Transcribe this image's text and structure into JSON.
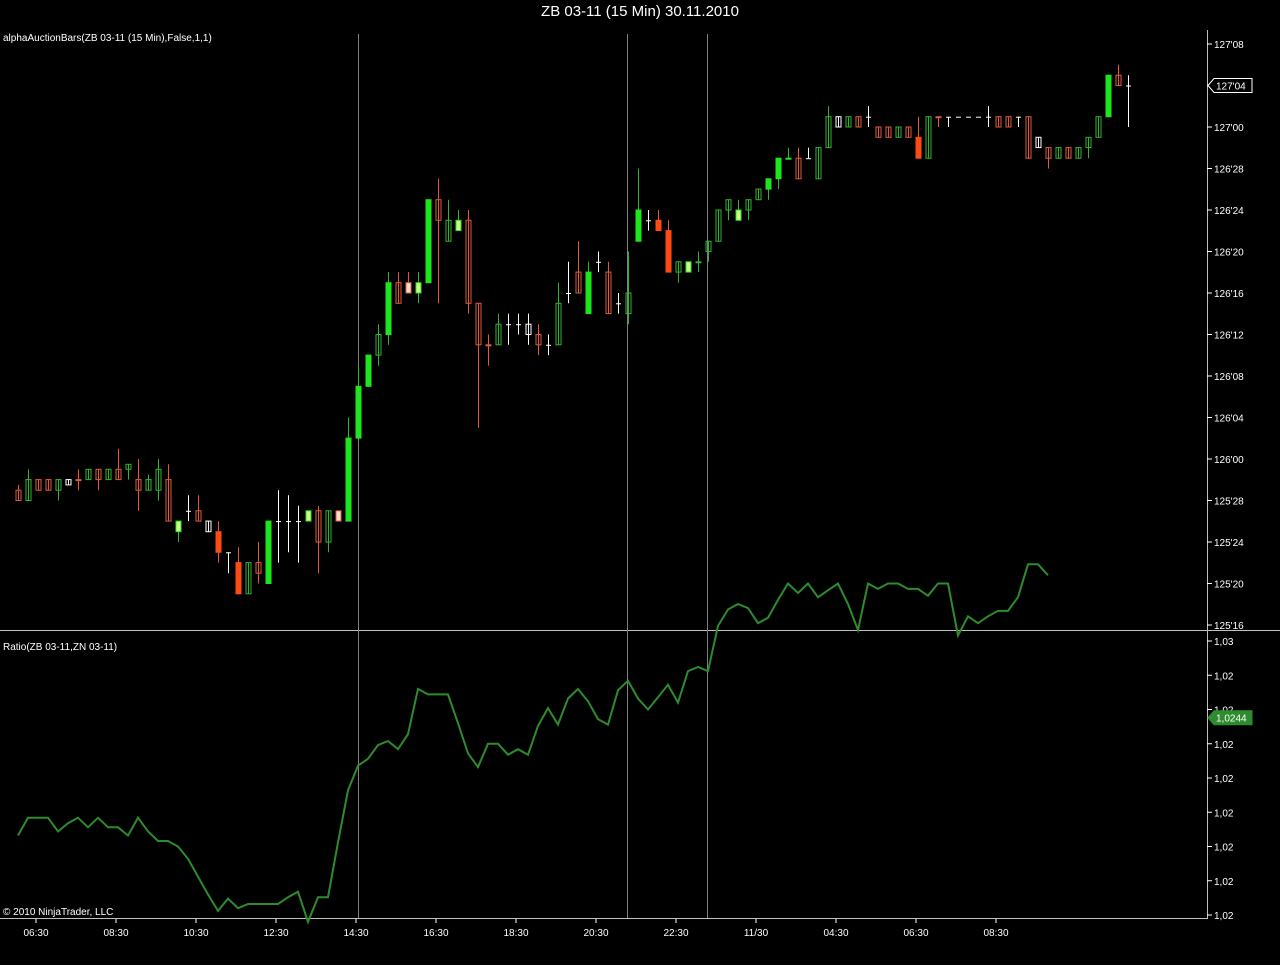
{
  "window": {
    "title": "ZB 03-11 (15 Min)  30.11.2010",
    "copyright": "© 2010 NinjaTrader, LLC"
  },
  "colors": {
    "background": "#000000",
    "up": "#1ee61e",
    "up_outline": "#32b432",
    "down": "#ff4a14",
    "down_outline": "#e05a3c",
    "neutral": "#ffffff",
    "ratio_line": "#2e8b2e",
    "axis": "#ffffff",
    "session_line": "#808080"
  },
  "chart_data": [
    {
      "type": "candlestick",
      "name": "alphaAuctionBars(ZB 03-11 (15 Min),False,1,1)",
      "y_axis": {
        "tick_labels": [
          "127'08",
          "127'04",
          "127'00",
          "126'28",
          "126'24",
          "126'20",
          "126'16",
          "126'12",
          "126'08",
          "126'04",
          "126'00",
          "125'28",
          "125'24",
          "125'20",
          "125'16"
        ],
        "tick_values": [
          127.25,
          127.125,
          127.0,
          126.875,
          126.75,
          126.625,
          126.5,
          126.375,
          126.25,
          126.125,
          126.0,
          125.875,
          125.75,
          125.625,
          125.5
        ],
        "range": [
          125.5,
          127.27
        ],
        "current_value_label": "127'04",
        "current_value": 127.125,
        "position": "right"
      },
      "x_axis": {
        "tick_labels": [
          "06:30",
          "08:30",
          "10:30",
          "12:30",
          "14:30",
          "16:30",
          "18:30",
          "20:30",
          "22:30",
          "11/30",
          "04:30",
          "06:30",
          "08:30"
        ]
      },
      "session_breaks": [
        "14:30",
        "21:15",
        "23:15"
      ],
      "bars": [
        {
          "o": 125.906,
          "h": 125.922,
          "l": 125.875,
          "c": 125.875,
          "k": "do"
        },
        {
          "o": 125.875,
          "h": 125.969,
          "l": 125.875,
          "c": 125.938,
          "k": "uo"
        },
        {
          "o": 125.906,
          "h": 125.938,
          "l": 125.906,
          "c": 125.938,
          "k": "do"
        },
        {
          "o": 125.906,
          "h": 125.938,
          "l": 125.906,
          "c": 125.938,
          "k": "do"
        },
        {
          "o": 125.938,
          "h": 125.938,
          "l": 125.875,
          "c": 125.906,
          "k": "uo"
        },
        {
          "o": 125.938,
          "h": 125.938,
          "l": 125.922,
          "c": 125.922,
          "k": "w"
        },
        {
          "o": 125.938,
          "h": 125.969,
          "l": 125.906,
          "c": 125.938,
          "k": "do"
        },
        {
          "o": 125.938,
          "h": 125.969,
          "l": 125.938,
          "c": 125.969,
          "k": "uo"
        },
        {
          "o": 125.969,
          "h": 125.969,
          "l": 125.906,
          "c": 125.938,
          "k": "do"
        },
        {
          "o": 125.938,
          "h": 125.969,
          "l": 125.938,
          "c": 125.969,
          "k": "uo"
        },
        {
          "o": 125.969,
          "h": 126.031,
          "l": 125.938,
          "c": 125.938,
          "k": "do"
        },
        {
          "o": 125.969,
          "h": 125.984,
          "l": 125.938,
          "c": 125.984,
          "k": "uo"
        },
        {
          "o": 125.938,
          "h": 126.0,
          "l": 125.844,
          "c": 125.906,
          "k": "do"
        },
        {
          "o": 125.906,
          "h": 125.953,
          "l": 125.906,
          "c": 125.938,
          "k": "uo"
        },
        {
          "o": 125.906,
          "h": 126.0,
          "l": 125.875,
          "c": 125.969,
          "k": "uo"
        },
        {
          "o": 125.938,
          "h": 125.984,
          "l": 125.813,
          "c": 125.813,
          "k": "do"
        },
        {
          "o": 125.813,
          "h": 125.813,
          "l": 125.75,
          "c": 125.781,
          "k": "ys"
        },
        {
          "o": 125.844,
          "h": 125.891,
          "l": 125.813,
          "c": 125.844,
          "k": "w"
        },
        {
          "o": 125.844,
          "h": 125.891,
          "l": 125.813,
          "c": 125.813,
          "k": "do"
        },
        {
          "o": 125.813,
          "h": 125.813,
          "l": 125.781,
          "c": 125.781,
          "k": "w"
        },
        {
          "o": 125.781,
          "h": 125.813,
          "l": 125.688,
          "c": 125.719,
          "k": "ds"
        },
        {
          "o": 125.719,
          "h": 125.719,
          "l": 125.656,
          "c": 125.719,
          "k": "w"
        },
        {
          "o": 125.688,
          "h": 125.734,
          "l": 125.594,
          "c": 125.594,
          "k": "ds"
        },
        {
          "o": 125.594,
          "h": 125.688,
          "l": 125.594,
          "c": 125.688,
          "k": "uo"
        },
        {
          "o": 125.688,
          "h": 125.75,
          "l": 125.625,
          "c": 125.656,
          "k": "do"
        },
        {
          "o": 125.625,
          "h": 125.813,
          "l": 125.625,
          "c": 125.813,
          "k": "us"
        },
        {
          "o": 125.813,
          "h": 125.906,
          "l": 125.688,
          "c": 125.813,
          "k": "w"
        },
        {
          "o": 125.813,
          "h": 125.891,
          "l": 125.719,
          "c": 125.813,
          "k": "w"
        },
        {
          "o": 125.813,
          "h": 125.859,
          "l": 125.688,
          "c": 125.813,
          "k": "w"
        },
        {
          "o": 125.844,
          "h": 125.844,
          "l": 125.813,
          "c": 125.813,
          "k": "ys"
        },
        {
          "o": 125.844,
          "h": 125.859,
          "l": 125.656,
          "c": 125.75,
          "k": "do"
        },
        {
          "o": 125.75,
          "h": 125.844,
          "l": 125.719,
          "c": 125.844,
          "k": "uo"
        },
        {
          "o": 125.844,
          "h": 125.844,
          "l": 125.813,
          "c": 125.813,
          "k": "pw"
        },
        {
          "o": 125.813,
          "h": 126.125,
          "l": 125.813,
          "c": 126.063,
          "k": "us"
        },
        {
          "o": 126.063,
          "h": 126.281,
          "l": 126.063,
          "c": 126.219,
          "k": "us"
        },
        {
          "o": 126.219,
          "h": 126.313,
          "l": 126.219,
          "c": 126.313,
          "k": "us"
        },
        {
          "o": 126.313,
          "h": 126.406,
          "l": 126.281,
          "c": 126.375,
          "k": "uo"
        },
        {
          "o": 126.375,
          "h": 126.563,
          "l": 126.344,
          "c": 126.531,
          "k": "us"
        },
        {
          "o": 126.531,
          "h": 126.563,
          "l": 126.469,
          "c": 126.469,
          "k": "do"
        },
        {
          "o": 126.531,
          "h": 126.563,
          "l": 126.5,
          "c": 126.5,
          "k": "pw"
        },
        {
          "o": 126.5,
          "h": 126.563,
          "l": 126.469,
          "c": 126.531,
          "k": "ys"
        },
        {
          "o": 126.531,
          "h": 126.781,
          "l": 126.531,
          "c": 126.781,
          "k": "us"
        },
        {
          "o": 126.781,
          "h": 126.844,
          "l": 126.469,
          "c": 126.719,
          "k": "do"
        },
        {
          "o": 126.656,
          "h": 126.781,
          "l": 126.656,
          "c": 126.719,
          "k": "uo"
        },
        {
          "o": 126.719,
          "h": 126.75,
          "l": 126.688,
          "c": 126.688,
          "k": "ys"
        },
        {
          "o": 126.719,
          "h": 126.75,
          "l": 126.438,
          "c": 126.469,
          "k": "do"
        },
        {
          "o": 126.469,
          "h": 126.469,
          "l": 126.094,
          "c": 126.344,
          "k": "do"
        },
        {
          "o": 126.344,
          "h": 126.375,
          "l": 126.281,
          "c": 126.344,
          "k": "pw"
        },
        {
          "o": 126.344,
          "h": 126.438,
          "l": 126.344,
          "c": 126.406,
          "k": "uo"
        },
        {
          "o": 126.406,
          "h": 126.438,
          "l": 126.344,
          "c": 126.406,
          "k": "w"
        },
        {
          "o": 126.406,
          "h": 126.438,
          "l": 126.375,
          "c": 126.406,
          "k": "w"
        },
        {
          "o": 126.406,
          "h": 126.438,
          "l": 126.344,
          "c": 126.375,
          "k": "w"
        },
        {
          "o": 126.375,
          "h": 126.406,
          "l": 126.313,
          "c": 126.344,
          "k": "do"
        },
        {
          "o": 126.344,
          "h": 126.375,
          "l": 126.313,
          "c": 126.344,
          "k": "w"
        },
        {
          "o": 126.344,
          "h": 126.531,
          "l": 126.344,
          "c": 126.469,
          "k": "uo"
        },
        {
          "o": 126.5,
          "h": 126.594,
          "l": 126.469,
          "c": 126.5,
          "k": "w"
        },
        {
          "o": 126.5,
          "h": 126.656,
          "l": 126.5,
          "c": 126.563,
          "k": "do"
        },
        {
          "o": 126.563,
          "h": 126.594,
          "l": 126.438,
          "c": 126.438,
          "k": "us"
        },
        {
          "o": 126.594,
          "h": 126.625,
          "l": 126.563,
          "c": 126.594,
          "k": "w"
        },
        {
          "o": 126.563,
          "h": 126.594,
          "l": 126.438,
          "c": 126.438,
          "k": "do"
        },
        {
          "o": 126.469,
          "h": 126.5,
          "l": 126.438,
          "c": 126.469,
          "k": "w"
        },
        {
          "o": 126.438,
          "h": 126.625,
          "l": 126.406,
          "c": 126.5,
          "k": "uo"
        },
        {
          "o": 126.656,
          "h": 126.875,
          "l": 126.656,
          "c": 126.75,
          "k": "us"
        },
        {
          "o": 126.719,
          "h": 126.75,
          "l": 126.688,
          "c": 126.719,
          "k": "w"
        },
        {
          "o": 126.719,
          "h": 126.75,
          "l": 126.688,
          "c": 126.688,
          "k": "ds"
        },
        {
          "o": 126.688,
          "h": 126.719,
          "l": 126.563,
          "c": 126.563,
          "k": "ds"
        },
        {
          "o": 126.594,
          "h": 126.594,
          "l": 126.531,
          "c": 126.563,
          "k": "uo"
        },
        {
          "o": 126.563,
          "h": 126.594,
          "l": 126.563,
          "c": 126.594,
          "k": "ys"
        },
        {
          "o": 126.594,
          "h": 126.625,
          "l": 126.563,
          "c": 126.594,
          "k": "uo"
        },
        {
          "o": 126.625,
          "h": 126.656,
          "l": 126.594,
          "c": 126.656,
          "k": "uo"
        },
        {
          "o": 126.656,
          "h": 126.75,
          "l": 126.656,
          "c": 126.75,
          "k": "uo"
        },
        {
          "o": 126.75,
          "h": 126.781,
          "l": 126.719,
          "c": 126.781,
          "k": "uo"
        },
        {
          "o": 126.75,
          "h": 126.781,
          "l": 126.719,
          "c": 126.719,
          "k": "ys"
        },
        {
          "o": 126.75,
          "h": 126.781,
          "l": 126.719,
          "c": 126.781,
          "k": "uo"
        },
        {
          "o": 126.781,
          "h": 126.813,
          "l": 126.781,
          "c": 126.813,
          "k": "uo"
        },
        {
          "o": 126.813,
          "h": 126.844,
          "l": 126.781,
          "c": 126.844,
          "k": "us"
        },
        {
          "o": 126.844,
          "h": 126.906,
          "l": 126.813,
          "c": 126.906,
          "k": "us"
        },
        {
          "o": 126.906,
          "h": 126.938,
          "l": 126.906,
          "c": 126.906,
          "k": "ys"
        },
        {
          "o": 126.906,
          "h": 126.938,
          "l": 126.844,
          "c": 126.844,
          "k": "do"
        },
        {
          "o": 126.906,
          "h": 126.938,
          "l": 126.906,
          "c": 126.906,
          "k": "w"
        },
        {
          "o": 126.844,
          "h": 126.938,
          "l": 126.844,
          "c": 126.938,
          "k": "uo"
        },
        {
          "o": 126.938,
          "h": 127.063,
          "l": 126.938,
          "c": 127.031,
          "k": "uo"
        },
        {
          "o": 127.031,
          "h": 127.031,
          "l": 127.0,
          "c": 127.0,
          "k": "w"
        },
        {
          "o": 127.0,
          "h": 127.031,
          "l": 127.0,
          "c": 127.031,
          "k": "uo"
        },
        {
          "o": 127.031,
          "h": 127.031,
          "l": 127.0,
          "c": 127.0,
          "k": "do"
        },
        {
          "o": 127.031,
          "h": 127.063,
          "l": 127.0,
          "c": 127.031,
          "k": "w"
        },
        {
          "o": 127.0,
          "h": 127.0,
          "l": 126.969,
          "c": 126.969,
          "k": "do"
        },
        {
          "o": 126.969,
          "h": 127.0,
          "l": 126.969,
          "c": 127.0,
          "k": "do"
        },
        {
          "o": 126.969,
          "h": 127.0,
          "l": 126.969,
          "c": 127.0,
          "k": "uo"
        },
        {
          "o": 127.0,
          "h": 127.0,
          "l": 126.969,
          "c": 126.969,
          "k": "do"
        },
        {
          "o": 126.969,
          "h": 127.031,
          "l": 126.906,
          "c": 126.906,
          "k": "ds"
        },
        {
          "o": 126.906,
          "h": 127.031,
          "l": 126.906,
          "c": 127.031,
          "k": "uo"
        },
        {
          "o": 127.031,
          "h": 127.031,
          "l": 127.0,
          "c": 127.031,
          "k": "do"
        },
        {
          "o": 127.031,
          "h": 127.031,
          "l": 127.0,
          "c": 127.031,
          "k": "w"
        },
        {
          "o": 127.031,
          "h": 127.031,
          "l": 127.031,
          "c": 127.031,
          "k": "w"
        },
        {
          "o": 127.031,
          "h": 127.031,
          "l": 127.031,
          "c": 127.031,
          "k": "w"
        },
        {
          "o": 127.031,
          "h": 127.031,
          "l": 127.031,
          "c": 127.031,
          "k": "w"
        },
        {
          "o": 127.031,
          "h": 127.063,
          "l": 127.0,
          "c": 127.031,
          "k": "w"
        },
        {
          "o": 127.031,
          "h": 127.031,
          "l": 127.0,
          "c": 127.0,
          "k": "do"
        },
        {
          "o": 127.031,
          "h": 127.031,
          "l": 127.0,
          "c": 127.0,
          "k": "do"
        },
        {
          "o": 127.031,
          "h": 127.031,
          "l": 127.0,
          "c": 127.031,
          "k": "w"
        },
        {
          "o": 127.031,
          "h": 127.031,
          "l": 126.906,
          "c": 126.906,
          "k": "do"
        },
        {
          "o": 126.969,
          "h": 126.969,
          "l": 126.938,
          "c": 126.938,
          "k": "w"
        },
        {
          "o": 126.938,
          "h": 126.938,
          "l": 126.875,
          "c": 126.906,
          "k": "do"
        },
        {
          "o": 126.906,
          "h": 126.938,
          "l": 126.906,
          "c": 126.938,
          "k": "uo"
        },
        {
          "o": 126.938,
          "h": 126.938,
          "l": 126.906,
          "c": 126.906,
          "k": "do"
        },
        {
          "o": 126.906,
          "h": 126.938,
          "l": 126.906,
          "c": 126.938,
          "k": "uo"
        },
        {
          "o": 126.938,
          "h": 126.969,
          "l": 126.906,
          "c": 126.969,
          "k": "uo"
        },
        {
          "o": 126.969,
          "h": 127.031,
          "l": 126.969,
          "c": 127.031,
          "k": "uo"
        },
        {
          "o": 127.031,
          "h": 127.156,
          "l": 127.031,
          "c": 127.156,
          "k": "us"
        },
        {
          "o": 127.156,
          "h": 127.188,
          "l": 127.125,
          "c": 127.125,
          "k": "do"
        },
        {
          "o": 127.125,
          "h": 127.156,
          "l": 127.0,
          "c": 127.125,
          "k": "w"
        }
      ]
    },
    {
      "type": "line",
      "name": "Ratio(ZB 03-11,ZN 03-11)",
      "y_axis": {
        "tick_labels": [
          "1,03",
          "1,02",
          "1,02",
          "1,02",
          "1,02",
          "1,02",
          "1,02",
          "1,02",
          "1,02"
        ],
        "tick_values": [
          1.03,
          1.0275,
          1.025,
          1.0225,
          1.02,
          1.0175,
          1.015,
          1.0125,
          1.01
        ],
        "range": [
          1.0094,
          1.0302
        ],
        "current_value_label": "1,0244",
        "current_value": 1.0244,
        "position": "right"
      },
      "values": [
        1.0158,
        1.0171,
        1.0171,
        1.0171,
        1.0161,
        1.0167,
        1.0171,
        1.0164,
        1.0171,
        1.0164,
        1.0164,
        1.0158,
        1.0171,
        1.0161,
        1.0154,
        1.0154,
        1.015,
        1.0141,
        1.0128,
        1.0115,
        1.0103,
        1.0112,
        1.0105,
        1.0108,
        1.0108,
        1.0108,
        1.0108,
        1.0113,
        1.0117,
        1.0095,
        1.0113,
        1.0113,
        1.0153,
        1.0191,
        1.0209,
        1.0214,
        1.0224,
        1.0227,
        1.0221,
        1.0232,
        1.0265,
        1.0261,
        1.0261,
        1.0261,
        1.024,
        1.0218,
        1.0208,
        1.0225,
        1.0225,
        1.0217,
        1.0221,
        1.0217,
        1.0238,
        1.0251,
        1.0239,
        1.0258,
        1.0265,
        1.0256,
        1.0243,
        1.0239,
        1.0264,
        1.0271,
        1.0258,
        1.025,
        1.0259,
        1.0268,
        1.0255,
        1.0278,
        1.0281,
        1.0278,
        1.0311,
        1.0323,
        1.0327,
        1.0324,
        1.0313,
        1.0317,
        1.033,
        1.0342,
        1.0335,
        1.0342,
        1.0332,
        1.0337,
        1.0342,
        1.0327,
        1.0308,
        1.0342,
        1.0338,
        1.0342,
        1.0342,
        1.0338,
        1.0338,
        1.0333,
        1.0342,
        1.0342,
        1.0304,
        1.0318,
        1.0313,
        1.0318,
        1.0322,
        1.0322,
        1.0332,
        1.0356,
        1.0356,
        1.0348
      ]
    }
  ]
}
